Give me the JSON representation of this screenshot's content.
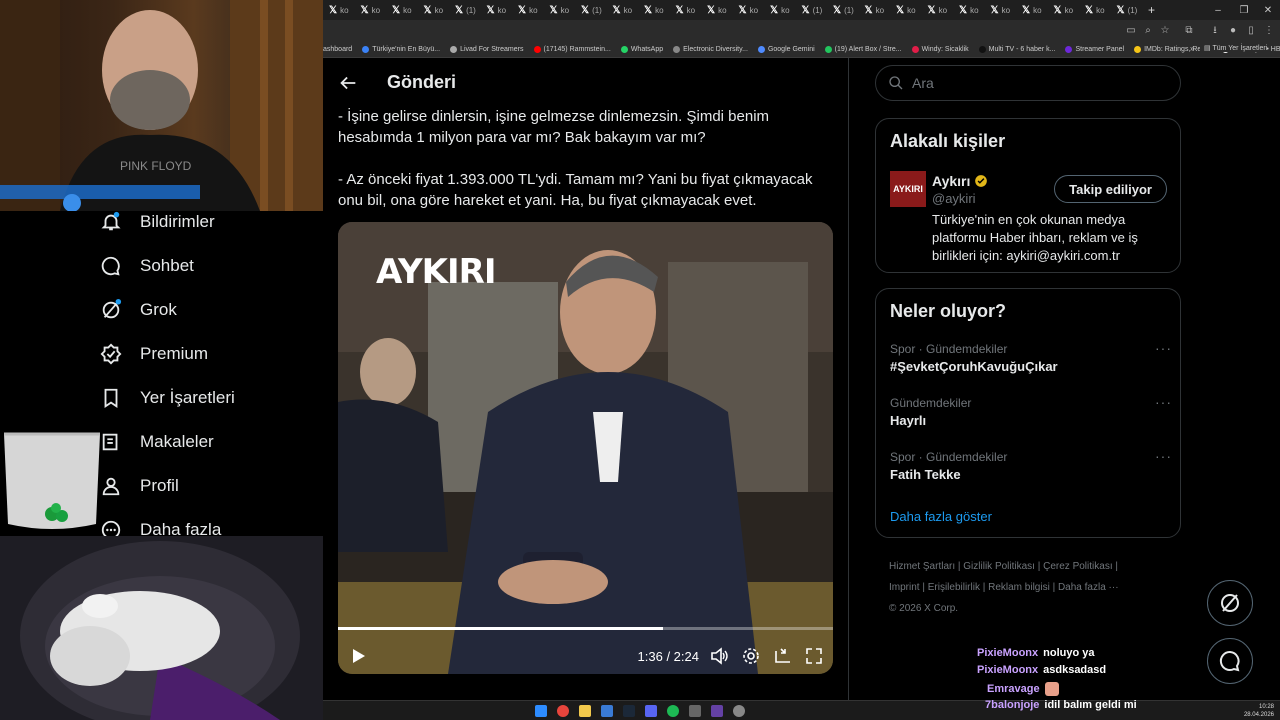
{
  "browser": {
    "tabs": [
      {
        "icon": "x-icon",
        "label": "ko"
      },
      {
        "icon": "x-icon",
        "label": "ko"
      },
      {
        "icon": "x-icon",
        "label": "ko"
      },
      {
        "icon": "x-icon",
        "label": "ko"
      },
      {
        "icon": "x-icon",
        "label": "(1)"
      },
      {
        "icon": "x-icon",
        "label": "ko"
      },
      {
        "icon": "x-icon",
        "label": "ko"
      },
      {
        "icon": "x-icon",
        "label": "ko"
      },
      {
        "icon": "x-icon",
        "label": "(1)"
      },
      {
        "icon": "x-icon",
        "label": "ko"
      },
      {
        "icon": "x-icon",
        "label": "ko"
      },
      {
        "icon": "x-icon",
        "label": "ko"
      },
      {
        "icon": "x-icon",
        "label": "ko"
      },
      {
        "icon": "x-icon",
        "label": "ko"
      },
      {
        "icon": "x-icon",
        "label": "ko"
      },
      {
        "icon": "x-icon",
        "label": "(1)"
      },
      {
        "icon": "x-icon",
        "label": "(1)"
      },
      {
        "icon": "x-icon",
        "label": "ko"
      },
      {
        "icon": "x-icon",
        "label": "ko"
      },
      {
        "icon": "x-icon",
        "label": "ko"
      },
      {
        "icon": "x-icon",
        "label": "ko"
      },
      {
        "icon": "x-icon",
        "label": "ko"
      },
      {
        "icon": "x-icon",
        "label": "ko"
      },
      {
        "icon": "x-icon",
        "label": "ko"
      },
      {
        "icon": "x-icon",
        "label": "ko"
      },
      {
        "icon": "x-icon",
        "label": "(1)"
      }
    ],
    "new_tab": "+",
    "bookmarks": [
      {
        "label": "ashboard",
        "color": ""
      },
      {
        "label": "Türkiye'nin En Büyü...",
        "color": "#3b82f6"
      },
      {
        "label": "Livad For Streamers",
        "color": "#aaaaaa"
      },
      {
        "label": "(17145) Rammstein...",
        "color": "#ff0000"
      },
      {
        "label": "WhatsApp",
        "color": "#25d366"
      },
      {
        "label": "Electronic Diversity...",
        "color": "#888888"
      },
      {
        "label": "Google Gemini",
        "color": "#4f8bff"
      },
      {
        "label": "(19) Alert Box / Stre...",
        "color": "#22c55e"
      },
      {
        "label": "Windy: Sicaklik",
        "color": "#e11d48"
      },
      {
        "label": "Multi TV - 6 haber k...",
        "color": "#111111"
      },
      {
        "label": "Streamer Panel",
        "color": "#6d28d9"
      },
      {
        "label": "IMDb: Ratings, Revi...",
        "color": "#f5c518"
      },
      {
        "label": "Ana Sayfa • HBO Max",
        "color": "#ffffff"
      }
    ],
    "bookmarks_more": "»",
    "all_bookmarks": "Tüm Yer İşaretleri"
  },
  "nav": {
    "items": [
      {
        "label": "Bildirimler",
        "icon": "bell-icon"
      },
      {
        "label": "Sohbet",
        "icon": "chat-icon"
      },
      {
        "label": "Grok",
        "icon": "grok-icon"
      },
      {
        "label": "Premium",
        "icon": "premium-icon"
      },
      {
        "label": "Yer İşaretleri",
        "icon": "bookmark-icon"
      },
      {
        "label": "Makaleler",
        "icon": "articles-icon"
      },
      {
        "label": "Profil",
        "icon": "profile-icon"
      },
      {
        "label": "Daha fazla",
        "icon": "more-icon"
      }
    ]
  },
  "post": {
    "header_title": "Gönderi",
    "paragraphs": [
      "- İşine gelirse dinlersin, işine gelmezse dinlemezsin. Şimdi benim hesabımda 1 milyon para var mı? Bak bakayım var mı?",
      "- Az önceki fiyat 1.393.000 TL'ydi. Tamam mı? Yani bu fiyat çıkmayacak onu bil, ona göre hareket et yani. Ha, bu fiyat çıkmayacak evet."
    ],
    "video": {
      "logo_text": "AYKIRI",
      "time": "1:36 / 2:24",
      "progress": 0.656
    }
  },
  "sidebar": {
    "search_placeholder": "Ara",
    "related": {
      "title": "Alakalı kişiler",
      "avatar_text": "AYKIRI",
      "name": "Aykırı",
      "handle": "@aykiri",
      "follow_label": "Takip ediliyor",
      "bio": "Türkiye'nin en çok okunan medya platformu Haber ihbarı, reklam ve iş birlikleri için: aykiri@aykiri.com.tr",
      "verified_color": "#e2b719"
    },
    "trends": {
      "title": "Neler oluyor?",
      "items": [
        {
          "meta": "Spor · Gündemdekiler",
          "name": "#ŞevketÇoruhKavuğuÇıkar"
        },
        {
          "meta": "Gündemdekiler",
          "name": "Hayrlı"
        },
        {
          "meta": "Spor · Gündemdekiler",
          "name": "Fatih Tekke"
        }
      ],
      "more_dots": "···",
      "show_more": "Daha fazla göster"
    },
    "footer": {
      "links": [
        "Hizmet Şartları",
        "Gizlilik Politikası",
        "Çerez Politikası",
        "Imprint",
        "Erişilebilirlik",
        "Reklam bilgisi",
        "Daha fazla ···"
      ],
      "copyright": "© 2026 X Corp."
    }
  },
  "chat": [
    {
      "user": "PixieMoonx",
      "message": "noluyo ya"
    },
    {
      "user": "PixieMoonx",
      "message": "asdksadasd"
    },
    {
      "user": "Emravage",
      "message": ""
    },
    {
      "user": "7balonjoje",
      "message": "idil balım geldi mi"
    }
  ],
  "taskbar": {
    "time": "10:28",
    "date": "28.04.2026"
  },
  "colors": {
    "accent": "#1d9bf0",
    "chat_user": "#c9a2ff"
  }
}
